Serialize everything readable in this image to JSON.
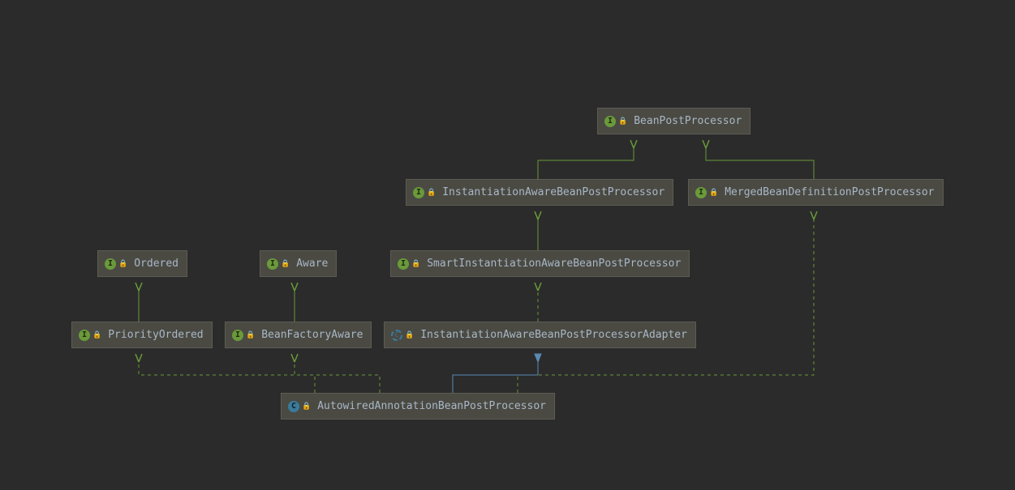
{
  "nodes": {
    "beanPostProcessor": {
      "name": "BeanPostProcessor",
      "kind": "interface"
    },
    "instAwareBPP": {
      "name": "InstantiationAwareBeanPostProcessor",
      "kind": "interface"
    },
    "mergedBeanDefPP": {
      "name": "MergedBeanDefinitionPostProcessor",
      "kind": "interface"
    },
    "smartInstAwareBPP": {
      "name": "SmartInstantiationAwareBeanPostProcessor",
      "kind": "interface"
    },
    "ordered": {
      "name": "Ordered",
      "kind": "interface"
    },
    "aware": {
      "name": "Aware",
      "kind": "interface"
    },
    "priorityOrdered": {
      "name": "PriorityOrdered",
      "kind": "interface"
    },
    "beanFactoryAware": {
      "name": "BeanFactoryAware",
      "kind": "interface"
    },
    "instAwareBPPAdapter": {
      "name": "InstantiationAwareBeanPostProcessorAdapter",
      "kind": "abstract"
    },
    "autowiredAnnotationBPP": {
      "name": "AutowiredAnnotationBeanPostProcessor",
      "kind": "class"
    }
  },
  "edges_implements": [
    {
      "from": "autowiredAnnotationBPP",
      "to": "priorityOrdered"
    },
    {
      "from": "autowiredAnnotationBPP",
      "to": "beanFactoryAware"
    },
    {
      "from": "autowiredAnnotationBPP",
      "to": "mergedBeanDefPP"
    }
  ],
  "edges_extends_class": [
    {
      "from": "autowiredAnnotationBPP",
      "to": "instAwareBPPAdapter"
    }
  ],
  "edges_extends_iface_or_impl": [
    {
      "from": "priorityOrdered",
      "to": "ordered"
    },
    {
      "from": "beanFactoryAware",
      "to": "aware"
    },
    {
      "from": "instAwareBPPAdapter",
      "to": "smartInstAwareBPP"
    },
    {
      "from": "smartInstAwareBPP",
      "to": "instAwareBPP"
    },
    {
      "from": "instAwareBPP",
      "to": "beanPostProcessor"
    },
    {
      "from": "mergedBeanDefPP",
      "to": "beanPostProcessor"
    }
  ],
  "glyphs": {
    "I": "I",
    "C": "C",
    "lock": "🔒"
  },
  "colors": {
    "green_line": "#6a9a3a",
    "blue_line": "#5a8ab4"
  }
}
